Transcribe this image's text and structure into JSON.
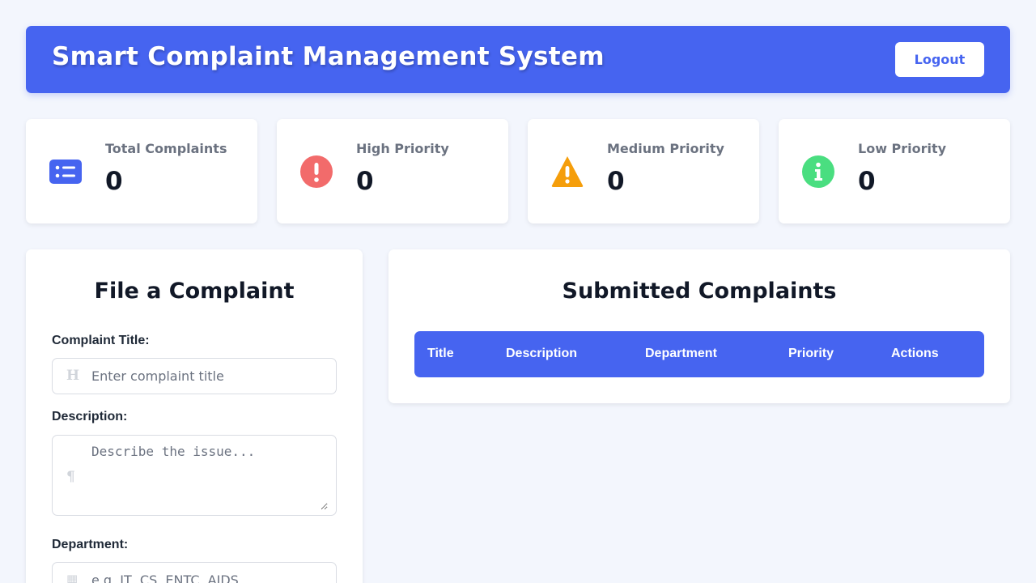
{
  "header": {
    "title": "Smart Complaint Management System",
    "logout_label": "Logout"
  },
  "stats": [
    {
      "label": "Total Complaints",
      "value": "0",
      "icon": "list-icon",
      "color": "#4664f0"
    },
    {
      "label": "High Priority",
      "value": "0",
      "icon": "exclamation-circle-icon",
      "color": "#f26b6b"
    },
    {
      "label": "Medium Priority",
      "value": "0",
      "icon": "warning-triangle-icon",
      "color": "#f59e0b"
    },
    {
      "label": "Low Priority",
      "value": "0",
      "icon": "info-circle-icon",
      "color": "#4ade80"
    }
  ],
  "form": {
    "title": "File a Complaint",
    "title_label": "Complaint Title:",
    "title_placeholder": "Enter complaint title",
    "title_icon": "heading-icon",
    "description_label": "Description:",
    "description_placeholder": "Describe the issue...",
    "description_icon": "paragraph-icon",
    "department_label": "Department:",
    "department_placeholder": "e.g. IT, CS, ENTC, AIDS",
    "department_icon": "building-icon"
  },
  "complaints": {
    "title": "Submitted Complaints",
    "columns": [
      "Title",
      "Description",
      "Department",
      "Priority",
      "Actions"
    ]
  },
  "colors": {
    "accent": "#4664f0",
    "background": "#f3f6fd"
  }
}
